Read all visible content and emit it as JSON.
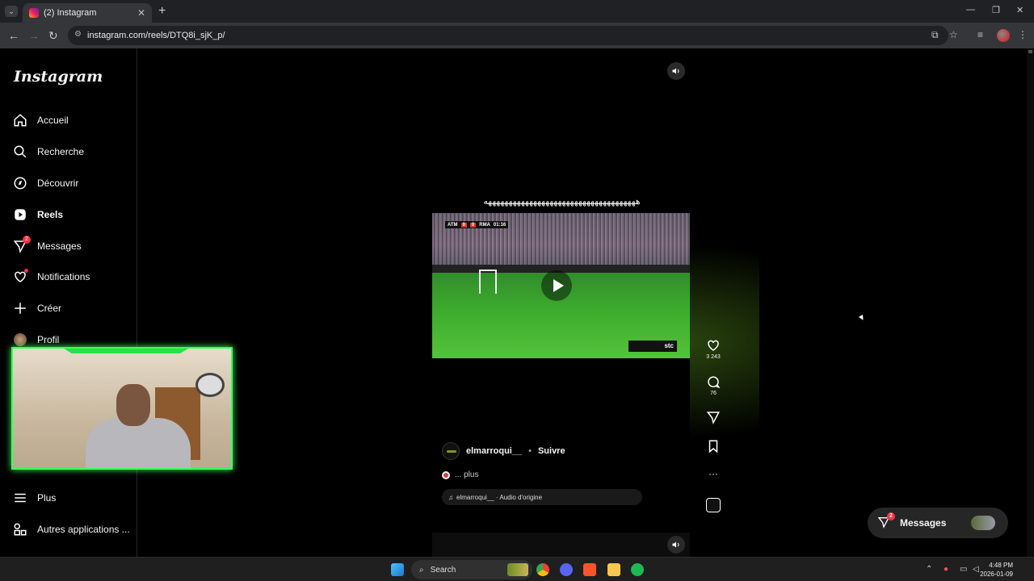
{
  "browser": {
    "tab_title": "(2) Instagram",
    "tab_close": "✕",
    "new_tab": "+",
    "url": "instagram.com/reels/DTQ8i_sjK_p/",
    "win_minimize": "—",
    "win_maximize": "❐",
    "win_close": "✕"
  },
  "sidebar": {
    "logo": "Instagram",
    "items": [
      {
        "label": "Accueil",
        "icon": "home-icon"
      },
      {
        "label": "Recherche",
        "icon": "search-icon"
      },
      {
        "label": "Découvrir",
        "icon": "compass-icon"
      },
      {
        "label": "Reels",
        "icon": "reels-icon"
      },
      {
        "label": "Messages",
        "icon": "messages-icon",
        "badge": "2"
      },
      {
        "label": "Notifications",
        "icon": "heart-icon"
      },
      {
        "label": "Créer",
        "icon": "plus-icon"
      },
      {
        "label": "Profil",
        "icon": "avatar"
      },
      {
        "label": "Plus",
        "icon": "menu-icon"
      },
      {
        "label": "Autres applications ...",
        "icon": "apps-icon"
      }
    ]
  },
  "reel": {
    "caption_overlay": "هههههههههههههههههههههههههههههههههههههه",
    "scoreboard": {
      "home": "ATM",
      "score_home": "0",
      "score_away": "0",
      "away": "RMA",
      "time": "01:16"
    },
    "broadcaster": "stc",
    "author": "elmarroqui__",
    "separator": "•",
    "follow_label": "Suivre",
    "caption_more": "... plus",
    "audio": "elmarroqui__ · Audio d'origine"
  },
  "actions": {
    "likes": "3 243",
    "comments": "76",
    "more": "···"
  },
  "messages_pill": {
    "label": "Messages",
    "badge": "2"
  },
  "taskbar": {
    "search": "Search",
    "time": "4:48 PM",
    "date": "2026-01-09"
  },
  "colors": {
    "accent_green": "#39ff5a",
    "notif_red": "#ff3040",
    "bg": "#000000"
  }
}
